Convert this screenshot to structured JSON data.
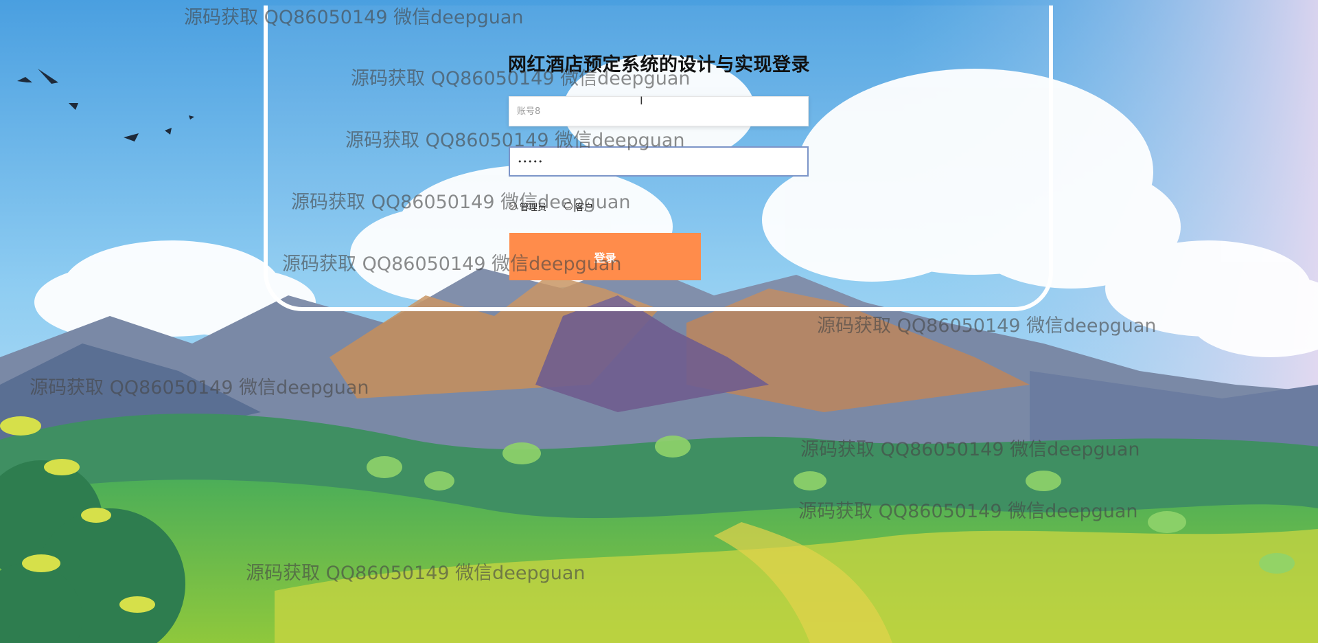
{
  "page": {
    "title": "网红酒店预定系统的设计与实现登录"
  },
  "login_form": {
    "username_placeholder": "账号8",
    "password_value": "•••••",
    "roles": [
      "管理员",
      "客户"
    ],
    "login_button_label": "登录"
  },
  "watermark": {
    "text": "源码获取 QQ86050149 微信deepguan"
  },
  "colors": {
    "login_button": "#ff8c4b",
    "panel_border": "#ffffff",
    "sky": "#7ec4ee"
  },
  "icons": {
    "cursor": "text-cursor-icon"
  }
}
